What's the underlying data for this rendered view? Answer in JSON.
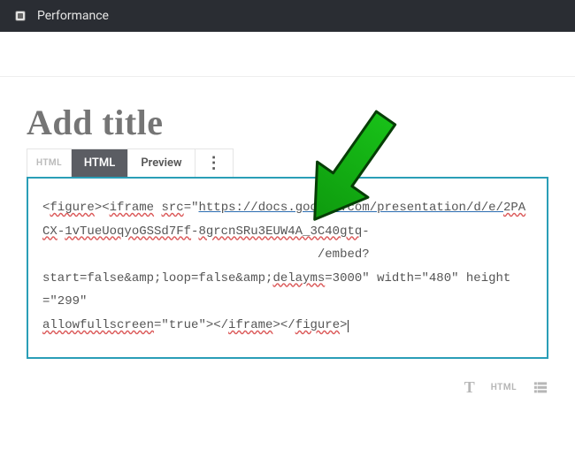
{
  "header": {
    "title": "Performance"
  },
  "editor": {
    "title_placeholder": "Add title",
    "tabs": {
      "small_label": "HTML",
      "html": "HTML",
      "preview": "Preview",
      "more_symbol": "⋮"
    },
    "code_parts": {
      "p1": "<",
      "p2": "figure",
      "p3": "><",
      "p4": "iframe",
      "p5": " ",
      "p6": "src",
      "p7": "=\"",
      "p8": "https://docs.google.com/presentation/d/e/",
      "p9": "2PACX",
      "p10": "-",
      "p11": "1vTueUoqyoGSSd7Ff",
      "p12": "-",
      "p13": "8grcnSRu3EUW4A_3C40gtq",
      "p14": "-",
      "p15": "                                     /embed?",
      "p16": "start=false&amp;loop=false&amp;",
      "p17": "delayms",
      "p18": "=3000\" width=\"480\" height=\"299\" ",
      "p19": "allowfullscreen",
      "p20": "=\"true\"></",
      "p21": "iframe",
      "p22": "></",
      "p23": "figure",
      "p24": ">"
    }
  },
  "footer": {
    "text_tool": "T",
    "html_tool": "HTML"
  }
}
